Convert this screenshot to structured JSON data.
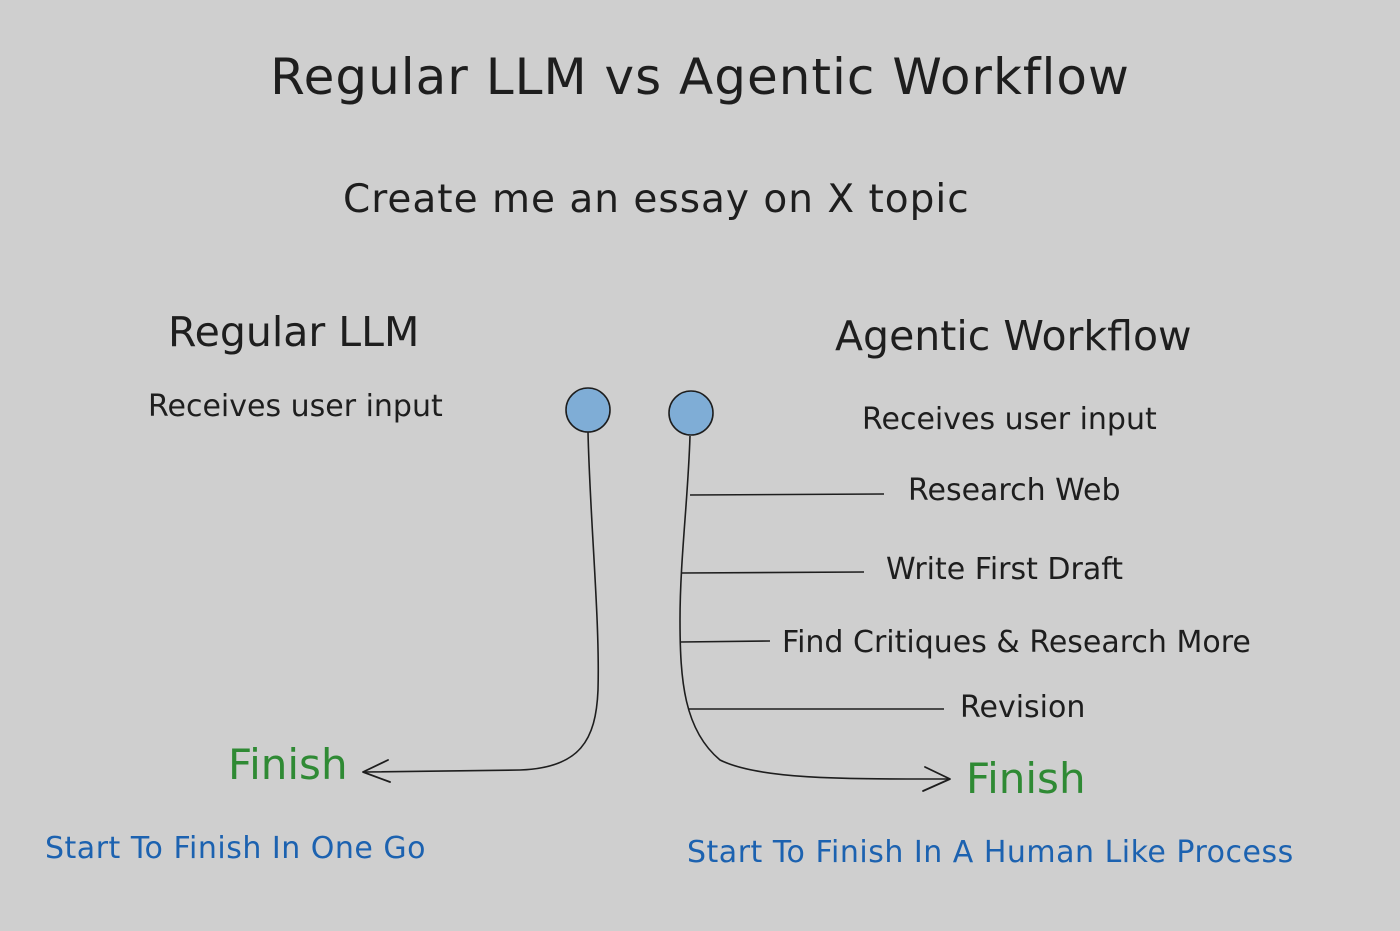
{
  "title": "Regular LLM vs Agentic Workflow",
  "prompt": "Create me an essay on X topic",
  "regular": {
    "heading": "Regular LLM",
    "input_label": "Receives user input",
    "finish_label": "Finish",
    "caption": "Start To Finish In One Go"
  },
  "agentic": {
    "heading": "Agentic Workflow",
    "input_label": "Receives user input",
    "steps": [
      "Research Web",
      "Write First Draft",
      "Find Critiques & Research More",
      "Revision"
    ],
    "finish_label": "Finish",
    "caption": "Start To Finish In A Human Like Process"
  },
  "colors": {
    "background": "#cfcfcf",
    "node_fill": "#7fadd6",
    "finish": "#2f8a34",
    "caption": "#1c62b0",
    "stroke": "#1e1e1e"
  }
}
